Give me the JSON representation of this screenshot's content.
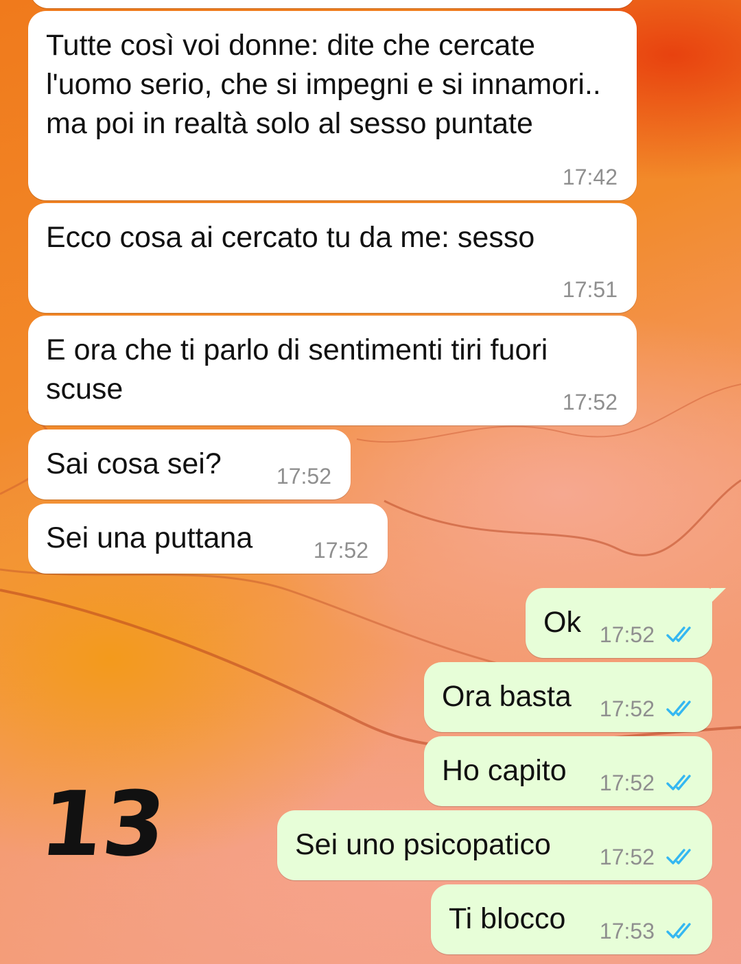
{
  "colors": {
    "incoming_bubble": "#ffffff",
    "outgoing_bubble": "#e7fed8",
    "timestamp": "#8f8f8f",
    "read_ticks": "#34b7f1"
  },
  "icons": {
    "read_receipt": "double-check-icon"
  },
  "overlay": {
    "number": "13"
  },
  "messages": [
    {
      "direction": "incoming",
      "text": "Tutte così voi donne: dite che cercate l'uomo serio, che si impegni e si innamori.. ma poi in realtà solo al sesso puntate",
      "time": "17:42"
    },
    {
      "direction": "incoming",
      "text": "Ecco cosa ai cercato tu da me: sesso",
      "time": "17:51"
    },
    {
      "direction": "incoming",
      "text": "E ora che ti parlo di sentimenti tiri fuori scuse",
      "time": "17:52"
    },
    {
      "direction": "incoming",
      "text": "Sai cosa sei?",
      "time": "17:52"
    },
    {
      "direction": "incoming",
      "text": "Sei una puttana",
      "time": "17:52"
    },
    {
      "direction": "outgoing",
      "text": "Ok",
      "time": "17:52",
      "status": "read"
    },
    {
      "direction": "outgoing",
      "text": "Ora basta",
      "time": "17:52",
      "status": "read"
    },
    {
      "direction": "outgoing",
      "text": "Ho capito",
      "time": "17:52",
      "status": "read"
    },
    {
      "direction": "outgoing",
      "text": "Sei uno psicopatico",
      "time": "17:52",
      "status": "read"
    },
    {
      "direction": "outgoing",
      "text": "Ti blocco",
      "time": "17:53",
      "status": "read"
    }
  ]
}
